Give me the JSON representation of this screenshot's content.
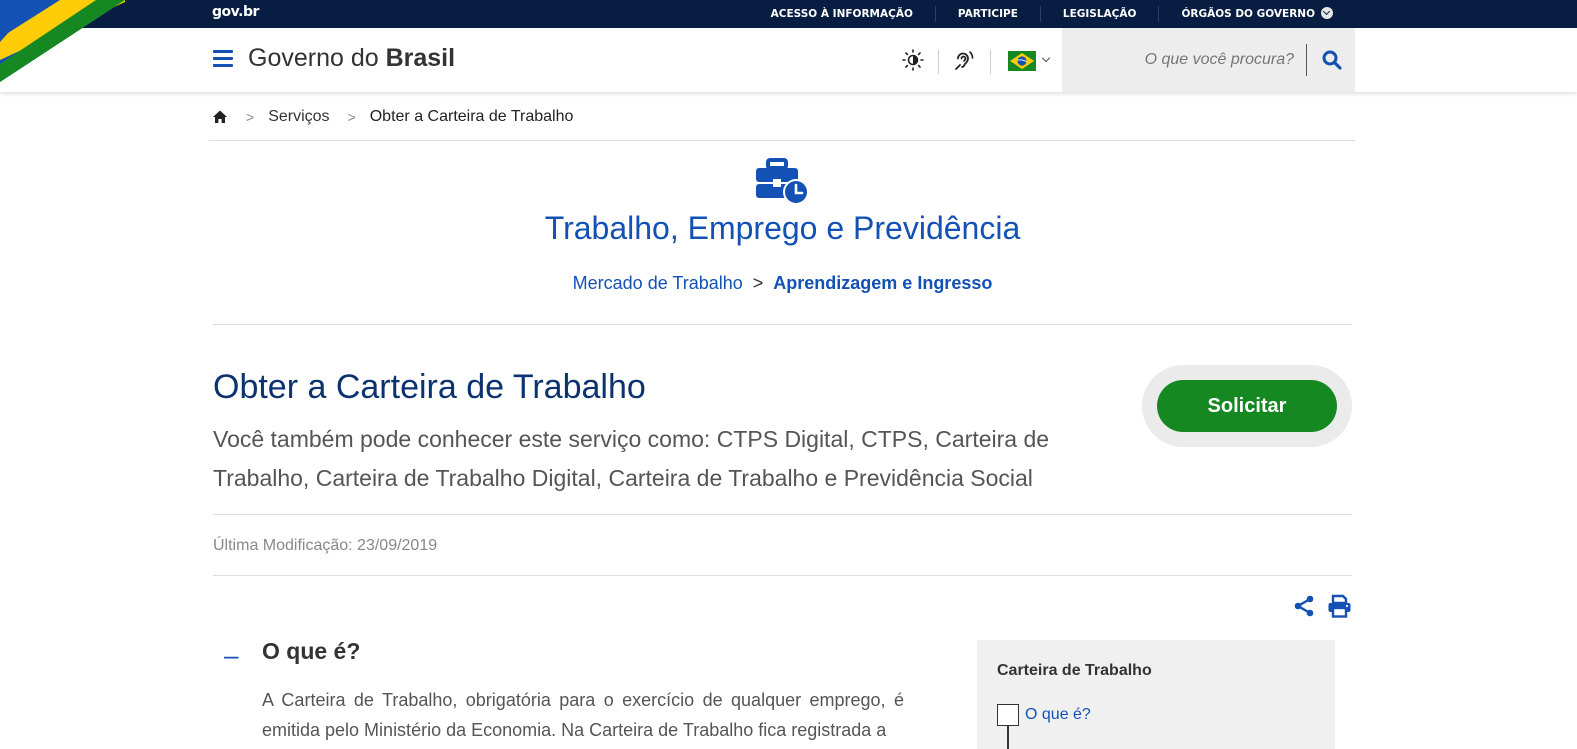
{
  "topbar": {
    "logo": "gov.br",
    "links": [
      "ACESSO À INFORMAÇÃO",
      "PARTICIPE",
      "LEGISLAÇÃO",
      "ÓRGÃOS DO GOVERNO"
    ]
  },
  "header": {
    "title_regular": "Governo do ",
    "title_bold": "Brasil",
    "search_placeholder": "O que você procura?",
    "icons": [
      "menu-icon",
      "contrast-icon",
      "accessibility-hearing-icon",
      "brazil-flag-icon",
      "search-icon"
    ]
  },
  "breadcrumb": {
    "items": [
      "Serviços",
      "Obter a Carteira de Trabalho"
    ],
    "separator": ">"
  },
  "category": {
    "title": "Trabalho, Emprego e Previdência",
    "subcategory": "Mercado de Trabalho",
    "separator": ">",
    "current": "Aprendizagem e Ingresso"
  },
  "service": {
    "title": "Obter a Carteira de Trabalho",
    "aka": "Você também pode conhecer este serviço como: CTPS Digital, CTPS, Carteira de Trabalho, Carteira de Trabalho Digital, Carteira de Trabalho e Previdência Social",
    "button": "Solicitar",
    "last_modified": "Última Modificação: 23/09/2019"
  },
  "section": {
    "toggle": "–",
    "title": "O que é?",
    "text": "A Carteira de Trabalho, obrigatória para o exercício de qualquer emprego, é emitida pelo Ministério da Economia. Na Carteira de Trabalho fica registrada a"
  },
  "side_index": {
    "title": "Carteira de Trabalho",
    "items": [
      "O que é?"
    ]
  },
  "colors": {
    "topbar": "#071d41",
    "primary": "#1351b4",
    "title": "#0c326f",
    "button": "#168821"
  }
}
